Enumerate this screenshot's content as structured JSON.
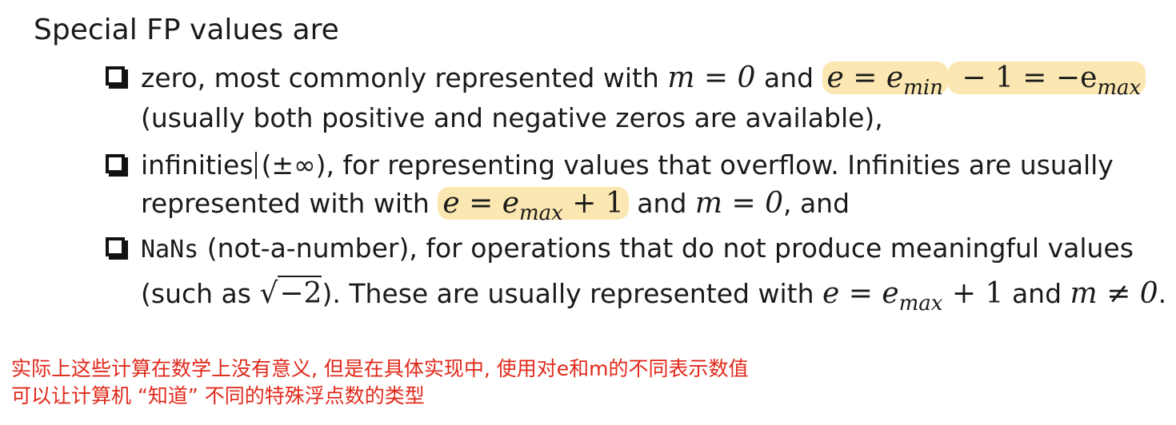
{
  "heading": "Special FP values are",
  "bullets": [
    {
      "line1": {
        "text_a": "zero, most commonly represented with ",
        "math_a": "m = 0",
        "text_b": " and ",
        "math_b1": "e = e",
        "math_b1_sub": "min",
        "math_b2": " − 1 = −e",
        "math_b2_sub": "max"
      },
      "line2": "(usually both positive and negative zeros are available),"
    },
    {
      "line1": {
        "text_a": "infinities",
        "text_b": "(±∞), for representing values that overflow. Infinities are usually"
      },
      "line2": {
        "text_a": "represented with with ",
        "math_a": "e = e",
        "math_a_sub": "max",
        "math_a_tail": " + 1",
        "text_b": " and ",
        "math_b": "m = 0",
        "text_c": ", and"
      }
    },
    {
      "line1": {
        "mono": "NaNs",
        "text": " (not-a-number), for operations that do not produce meaningful values"
      },
      "line2": {
        "text_a": "(such as ",
        "sqrt_symbol": "√",
        "sqrt_radicand": "−2",
        "text_b": "). These are usually represented with ",
        "math_a": "e = e",
        "math_a_sub": "max",
        "math_a_tail": " + 1",
        "text_c": " and ",
        "math_b": "m ≠ 0",
        "text_d": "."
      }
    }
  ],
  "note": {
    "line1": "实际上这些计算在数学上没有意义, 但是在具体实现中, 使用对e和m的不同表示数值",
    "line2": "可以让计算机 “知道” 不同的特殊浮点数的类型"
  },
  "colors": {
    "highlight": "#fbe7b1",
    "note_text": "#e0291b",
    "body_text": "#1a1a1a"
  }
}
